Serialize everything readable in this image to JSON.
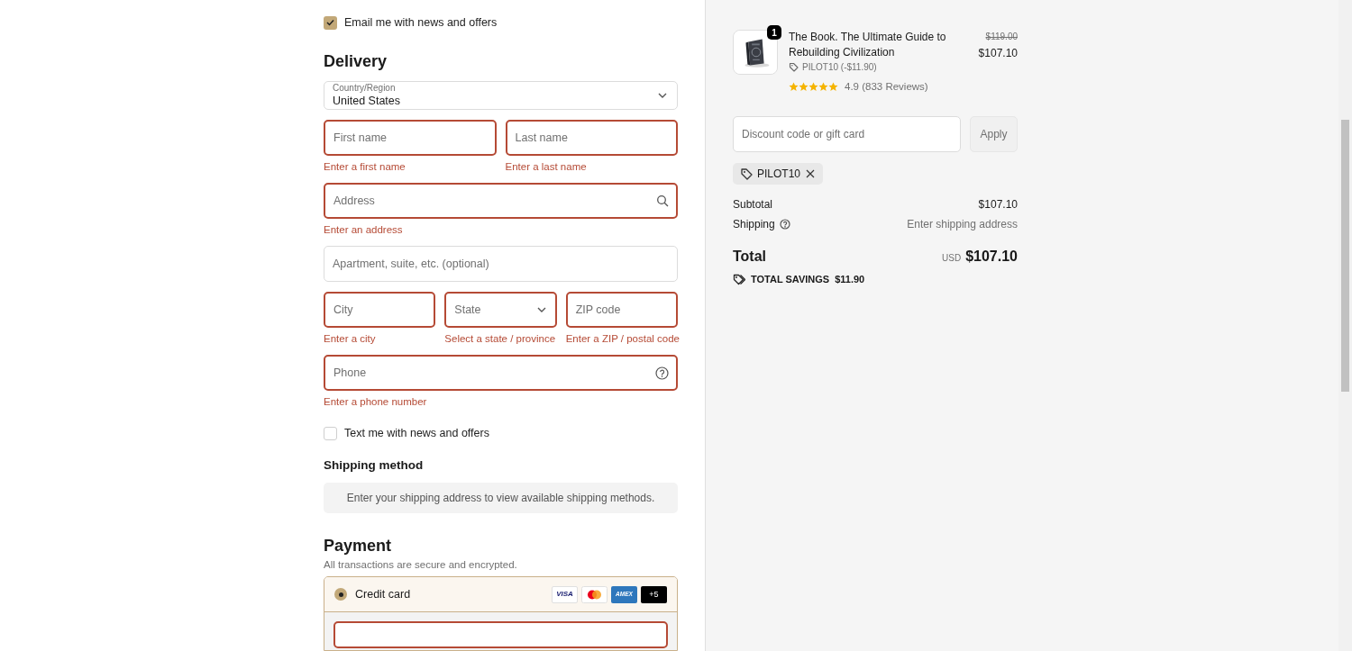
{
  "marketing_email": {
    "label": "Email me with news and offers",
    "checked": true
  },
  "delivery": {
    "title": "Delivery",
    "country": {
      "label": "Country/Region",
      "value": "United States"
    },
    "rows": [
      [
        {
          "kind": "input",
          "placeholder": "First name",
          "invalid": true,
          "error": "Enter a first name"
        },
        {
          "kind": "input",
          "placeholder": "Last name",
          "invalid": true,
          "error": "Enter a last name"
        }
      ],
      [
        {
          "kind": "search",
          "placeholder": "Address",
          "invalid": true,
          "error": "Enter an address"
        }
      ],
      [
        {
          "kind": "input",
          "placeholder": "Apartment, suite, etc. (optional)",
          "invalid": false
        }
      ],
      [
        {
          "kind": "input",
          "placeholder": "City",
          "invalid": true,
          "error": "Enter a city"
        },
        {
          "kind": "select",
          "placeholder": "State",
          "invalid": true,
          "error": "Select a state / province"
        },
        {
          "kind": "input",
          "placeholder": "ZIP code",
          "invalid": true,
          "error": "Enter a ZIP / postal code"
        }
      ],
      [
        {
          "kind": "help",
          "placeholder": "Phone",
          "invalid": true,
          "error": "Enter a phone number"
        }
      ]
    ]
  },
  "marketing_sms": {
    "label": "Text me with news and offers",
    "checked": false
  },
  "shipping_method": {
    "title": "Shipping method",
    "message": "Enter your shipping address to view available shipping methods."
  },
  "payment": {
    "title": "Payment",
    "subtitle": "All transactions are secure and encrypted.",
    "methods": [
      {
        "label": "Credit card",
        "selected": true,
        "cards": [
          {
            "kind": "visa",
            "label": "VISA"
          },
          {
            "kind": "mastercard"
          },
          {
            "kind": "amex",
            "label": "AMEX"
          },
          {
            "kind": "more",
            "label": "+5"
          }
        ]
      }
    ]
  },
  "summary": {
    "item": {
      "quantity": "1",
      "title": "The Book. The Ultimate Guide to Rebuilding Civilization",
      "discount": "PILOT10 (-$11.90)",
      "stars": 5,
      "rating": "4.9 (833 Reviews)",
      "original_price": "$119.00",
      "price": "$107.10"
    },
    "discount": {
      "placeholder": "Discount code or gift card",
      "button": "Apply",
      "applied": [
        "PILOT10"
      ]
    },
    "lines": [
      {
        "label": "Subtotal",
        "value": "$107.10",
        "help": false
      },
      {
        "label": "Shipping",
        "value": "Enter shipping address",
        "help": true
      }
    ],
    "total": {
      "label": "Total",
      "currency": "USD",
      "amount": "$107.10"
    },
    "savings": {
      "label": "TOTAL SAVINGS",
      "amount": "$11.90"
    }
  }
}
